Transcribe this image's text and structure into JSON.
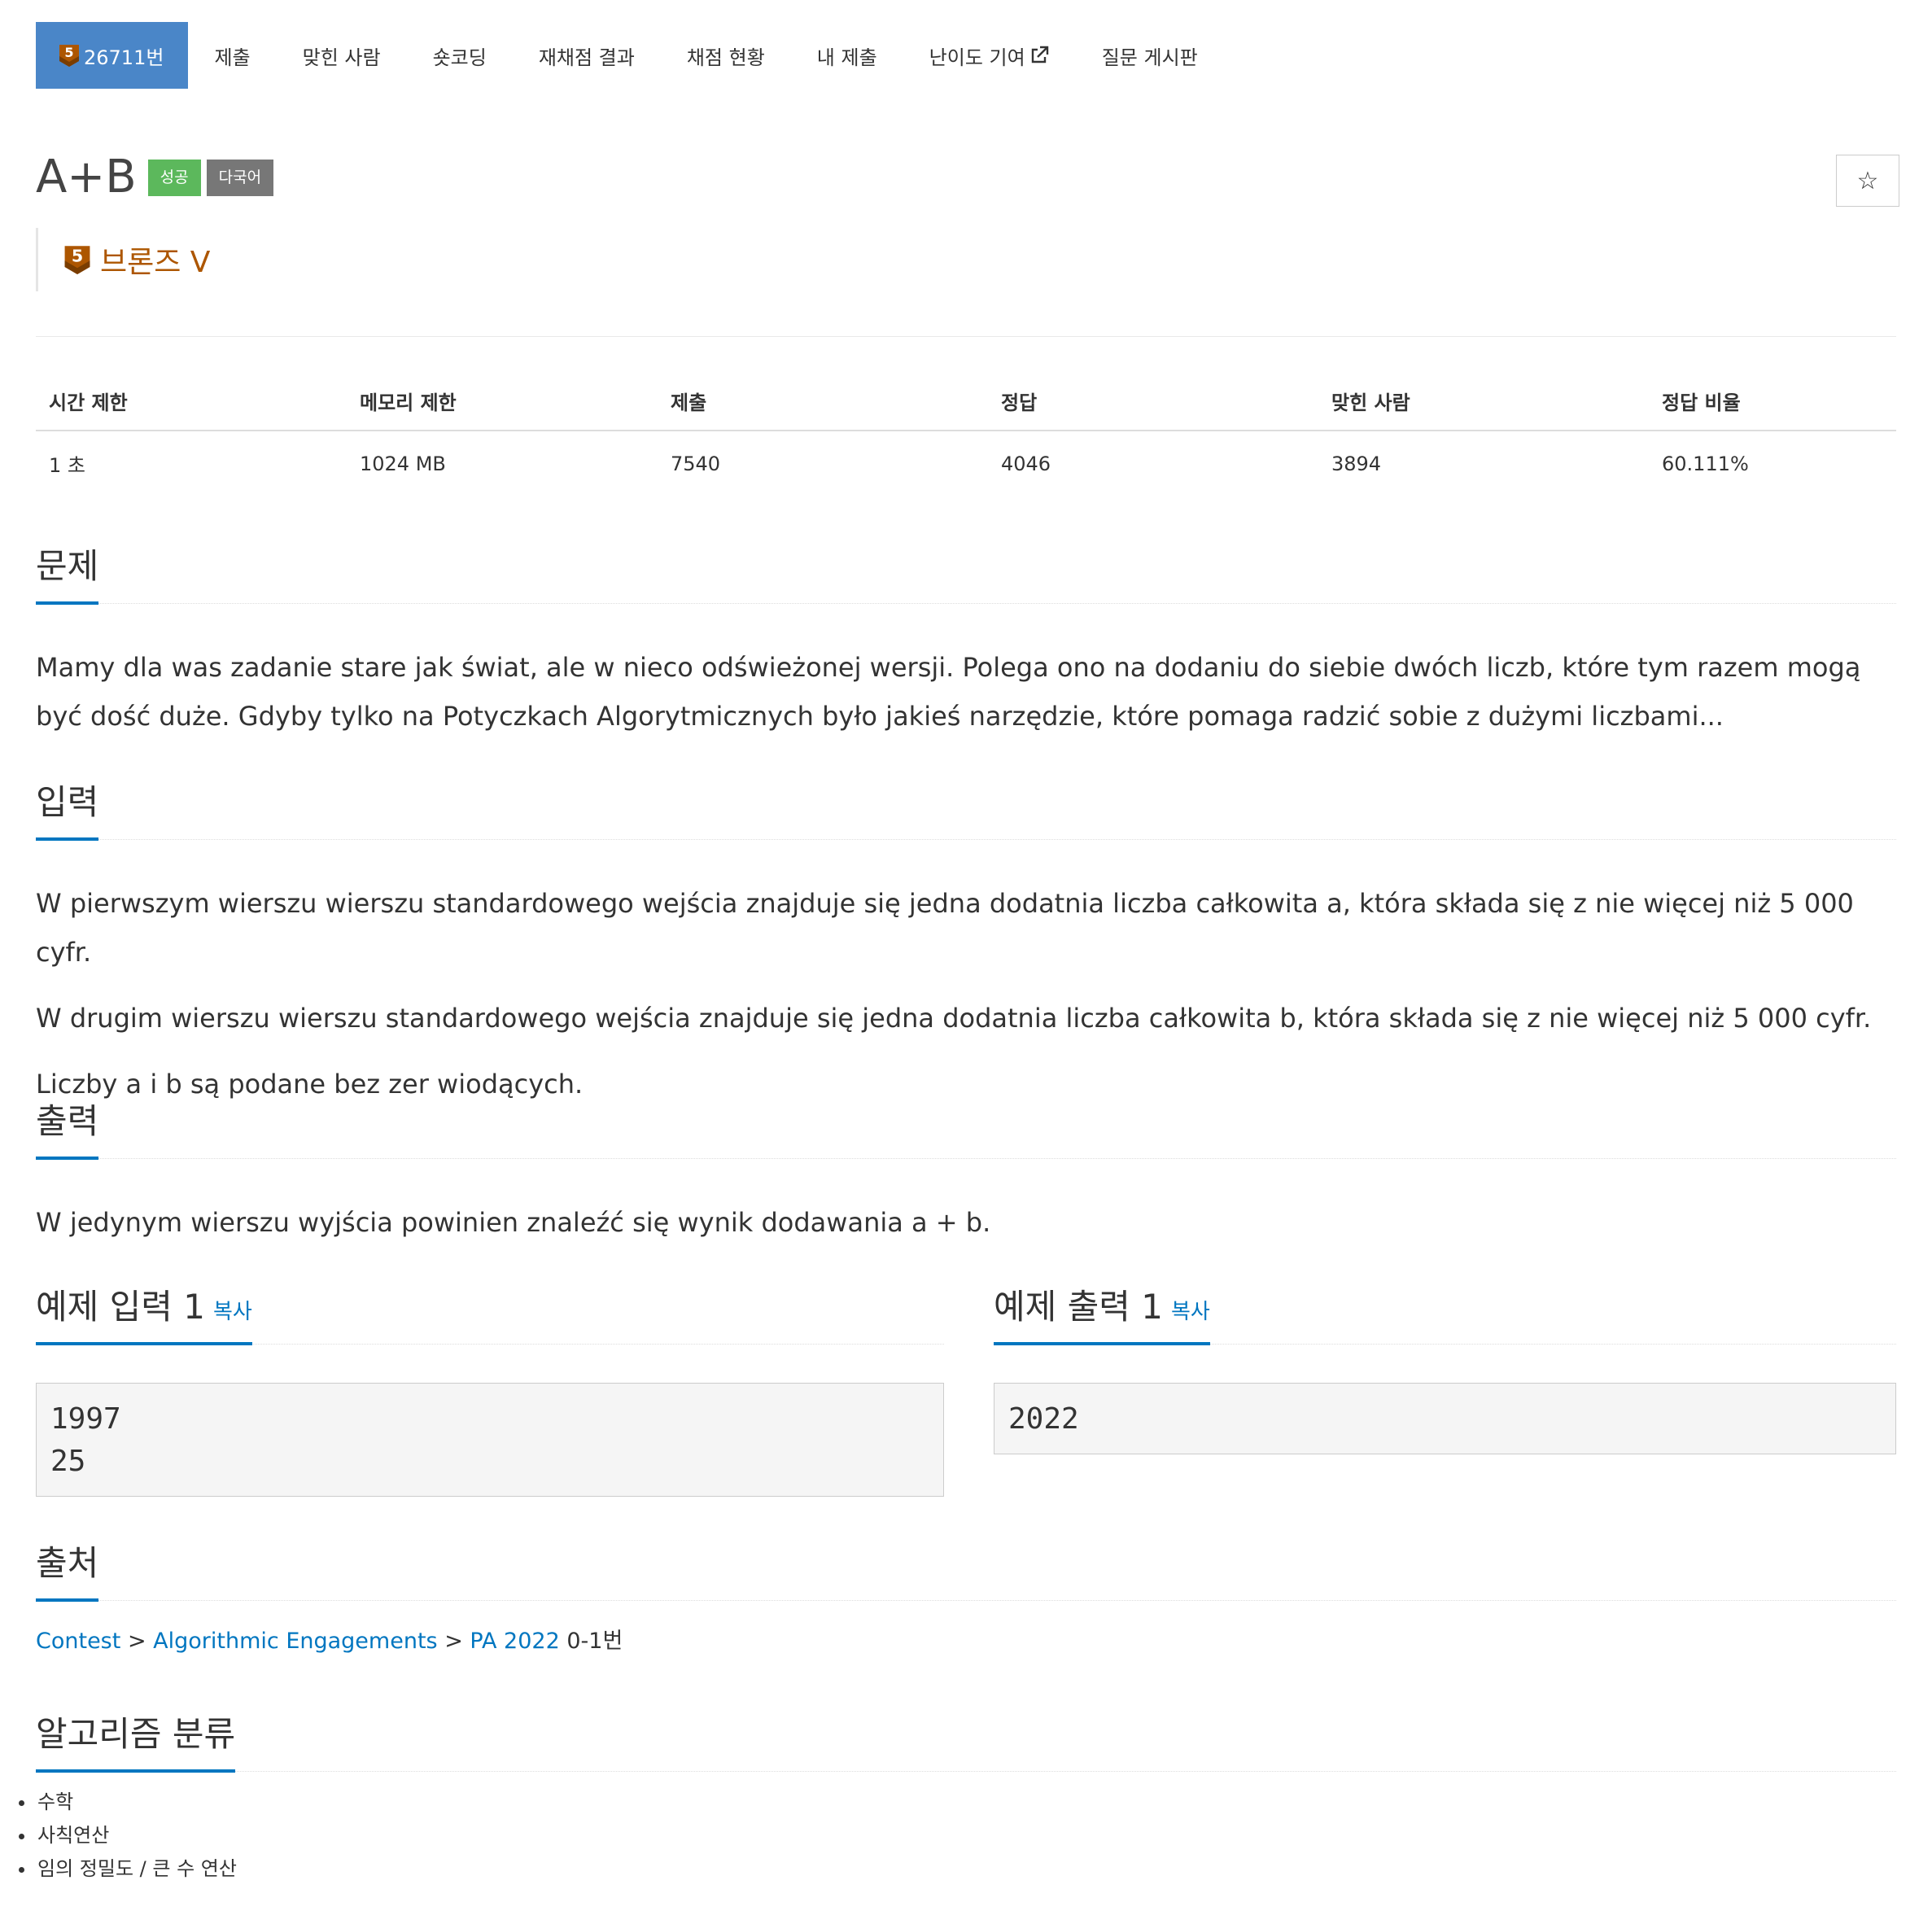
{
  "nav": {
    "active_tab": "26711번",
    "tier_number": "5",
    "tabs": [
      "제출",
      "맞힌 사람",
      "숏코딩",
      "재채점 결과",
      "채점 현황",
      "내 제출",
      "난이도 기여",
      "질문 게시판"
    ]
  },
  "problem": {
    "title": "A+B",
    "label_success": "성공",
    "label_multilang": "다국어",
    "star": "☆",
    "tier_text": "브론즈 V",
    "tier_color": "#ad5600"
  },
  "stats": {
    "headers": [
      "시간 제한",
      "메모리 제한",
      "제출",
      "정답",
      "맞힌 사람",
      "정답 비율"
    ],
    "values": [
      "1 초",
      "1024 MB",
      "7540",
      "4046",
      "3894",
      "60.111%"
    ]
  },
  "sections": {
    "description_title": "문제",
    "description": "Mamy dla was zadanie stare jak świat, ale w nieco odświeżonej wersji. Polega ono na dodaniu do siebie dwóch liczb, które tym razem mogą być dość duże. Gdyby tylko na Potyczkach Algorytmicznych było jakieś narzędzie, które pomaga radzić sobie z dużymi liczbami...",
    "input_title": "입력",
    "input_lines": [
      "W pierwszym wierszu wierszu standardowego wejścia znajduje się jedna dodatnia liczba całkowita a, która składa się z nie więcej niż 5 000 cyfr.",
      "W drugim wierszu wierszu standardowego wejścia znajduje się jedna dodatnia liczba całkowita b, która składa się z nie więcej niż 5 000 cyfr.",
      "Liczby a i b są podane bez zer wiodących."
    ],
    "output_title": "출력",
    "output": "W jedynym wierszu wyjścia powinien znaleźć się wynik dodawania a + b.",
    "sample_input_title": "예제 입력 1",
    "sample_output_title": "예제 출력 1",
    "copy_label": "복사",
    "sample_input": "1997\n25",
    "sample_output": "2022",
    "source_title": "출처",
    "source_links": [
      "Contest",
      "Algorithmic Engagements",
      "PA 2022"
    ],
    "source_sep": ">",
    "source_suffix": "0-1번",
    "algo_title": "알고리즘 분류",
    "algos": [
      "수학",
      "사칙연산",
      "임의 정밀도 / 큰 수 연산"
    ]
  },
  "colors": {
    "nav_active": "#4a86c8",
    "link": "#0076c0",
    "success": "#5cb85c",
    "multilang": "#777777"
  }
}
